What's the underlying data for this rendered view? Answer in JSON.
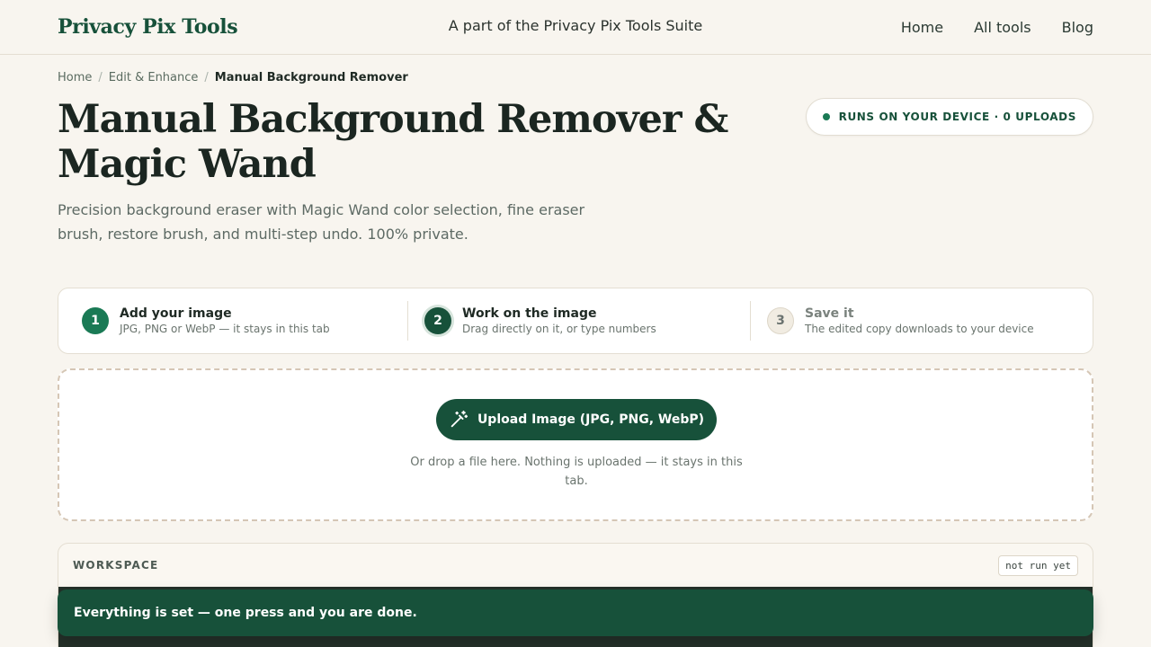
{
  "header": {
    "brand": "Privacy Pix Tools",
    "suite_text": "A part of the Privacy Pix Tools Suite",
    "nav": [
      "Home",
      "All tools",
      "Blog"
    ]
  },
  "breadcrumb": {
    "items": [
      "Home",
      "Edit & Enhance"
    ],
    "current": "Manual Background Remover",
    "separator": "/"
  },
  "page": {
    "title": "Manual Background Remover & Magic Wand",
    "subtitle": "Precision background eraser with Magic Wand color selection, fine eraser brush, restore brush, and multi-step undo. 100% private.",
    "badge": "RUNS ON YOUR DEVICE · 0 UPLOADS"
  },
  "steps": [
    {
      "num": "1",
      "title": "Add your image",
      "desc": "JPG, PNG or WebP — it stays in this tab"
    },
    {
      "num": "2",
      "title": "Work on the image",
      "desc": "Drag directly on it, or type numbers"
    },
    {
      "num": "3",
      "title": "Save it",
      "desc": "The edited copy downloads to your device"
    }
  ],
  "upload": {
    "button_label": "Upload Image (JPG, PNG, WebP)",
    "icon": "magic-wand-icon",
    "hint": "Or drop a file here. Nothing is uploaded — it stays in this tab."
  },
  "workspace": {
    "label": "WORKSPACE",
    "status": "not run yet"
  },
  "toast": {
    "message": "Everything is set — one press and you are done."
  },
  "colors": {
    "brand_green": "#17513a",
    "accent_green": "#1a7a55",
    "background": "#f8f5ef"
  }
}
